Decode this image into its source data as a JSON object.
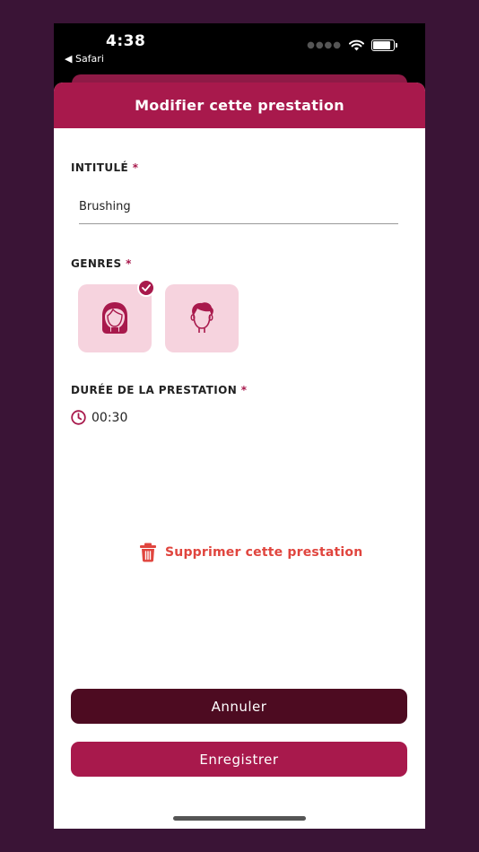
{
  "status_bar": {
    "time": "4:38",
    "back_app": "◀ Safari"
  },
  "sheet": {
    "title": "Modifier cette prestation"
  },
  "form": {
    "name_label": "INTITULÉ",
    "name_value": "Brushing",
    "required_mark": "*",
    "genres_label": "GENRES",
    "genres": [
      {
        "icon": "woman-face-icon",
        "selected": true
      },
      {
        "icon": "man-face-icon",
        "selected": false
      }
    ],
    "duration_label": "DURÉE DE LA PRESTATION",
    "duration_value": "00:30"
  },
  "delete_label": "Supprimer cette prestation",
  "buttons": {
    "cancel": "Annuler",
    "save": "Enregistrer"
  },
  "colors": {
    "brand": "#a8194c",
    "brand_dark": "#4d0b21",
    "tile_bg": "#f6d3de",
    "danger": "#e0453e",
    "backdrop": "#3a1436"
  }
}
